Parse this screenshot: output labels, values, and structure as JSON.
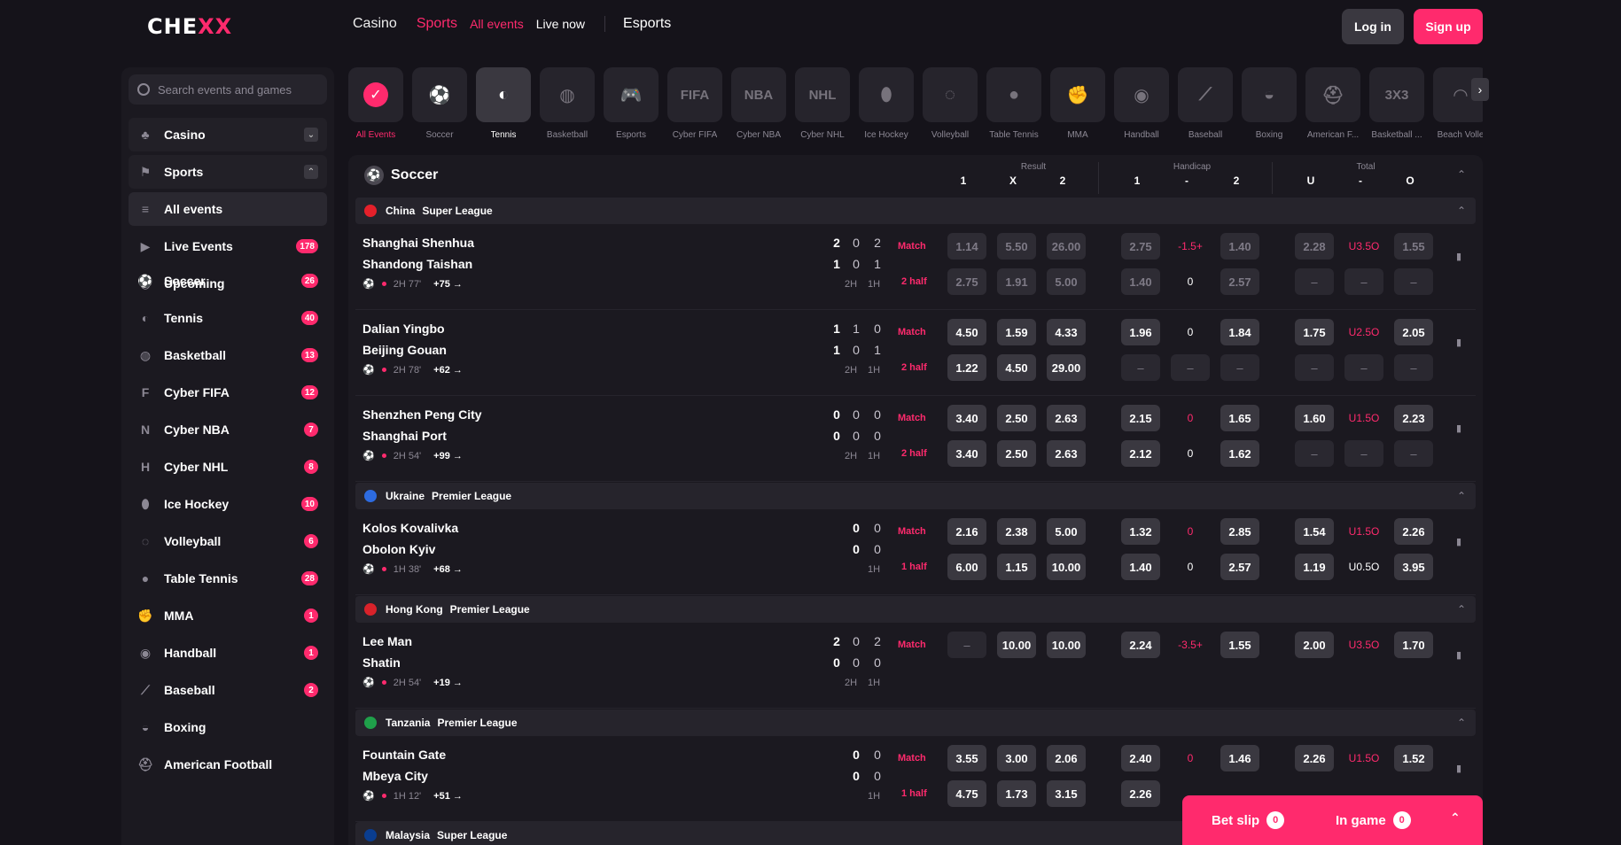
{
  "header": {
    "logo_left": "CHE",
    "logo_xx": "XX",
    "nav": {
      "casino": "Casino",
      "sports": "Sports",
      "all_events": "All events",
      "live_now": "Live now",
      "esports": "Esports"
    },
    "login": "Log in",
    "signup": "Sign up"
  },
  "sidebar": {
    "search_placeholder": "Search events and games",
    "casino": "Casino",
    "sports": "Sports",
    "items": [
      {
        "label": "All events",
        "count": "",
        "icon": "list-icon"
      },
      {
        "label": "Live Events",
        "count": "178",
        "icon": "play-icon"
      },
      {
        "label": "Upcoming",
        "count": "",
        "icon": "clock-icon"
      },
      {
        "label": "Soccer",
        "count": "26",
        "icon": "soccer-icon"
      },
      {
        "label": "Tennis",
        "count": "40",
        "icon": "tennis-icon"
      },
      {
        "label": "Basketball",
        "count": "13",
        "icon": "basketball-icon"
      },
      {
        "label": "Cyber FIFA",
        "count": "12",
        "icon": "fifa-icon"
      },
      {
        "label": "Cyber NBA",
        "count": "7",
        "icon": "nba-icon"
      },
      {
        "label": "Cyber NHL",
        "count": "8",
        "icon": "nhl-icon"
      },
      {
        "label": "Ice Hockey",
        "count": "10",
        "icon": "ice-hockey-icon"
      },
      {
        "label": "Volleyball",
        "count": "6",
        "icon": "volleyball-icon"
      },
      {
        "label": "Table Tennis",
        "count": "28",
        "icon": "table-tennis-icon"
      },
      {
        "label": "MMA",
        "count": "1",
        "icon": "mma-icon"
      },
      {
        "label": "Handball",
        "count": "1",
        "icon": "handball-icon"
      },
      {
        "label": "Baseball",
        "count": "2",
        "icon": "baseball-icon"
      },
      {
        "label": "Boxing",
        "count": "",
        "icon": "boxing-icon"
      },
      {
        "label": "American Football",
        "count": "",
        "icon": "american-football-icon"
      }
    ]
  },
  "tabs": [
    {
      "label": "All Events",
      "glyph": "✓"
    },
    {
      "label": "Soccer",
      "glyph": "⚽"
    },
    {
      "label": "Tennis",
      "glyph": "◐"
    },
    {
      "label": "Basketball",
      "glyph": "◍"
    },
    {
      "label": "Esports",
      "glyph": "🎮"
    },
    {
      "label": "Cyber FIFA",
      "glyph": "FIFA"
    },
    {
      "label": "Cyber NBA",
      "glyph": "NBA"
    },
    {
      "label": "Cyber NHL",
      "glyph": "NHL"
    },
    {
      "label": "Ice Hockey",
      "glyph": "⬮"
    },
    {
      "label": "Volleyball",
      "glyph": "◌"
    },
    {
      "label": "Table Tennis",
      "glyph": "●"
    },
    {
      "label": "MMA",
      "glyph": "✊"
    },
    {
      "label": "Handball",
      "glyph": "◉"
    },
    {
      "label": "Baseball",
      "glyph": "⟋"
    },
    {
      "label": "Boxing",
      "glyph": "◒"
    },
    {
      "label": "American F...",
      "glyph": "⛑"
    },
    {
      "label": "Basketball ...",
      "glyph": "3X3"
    },
    {
      "label": "Beach Volle",
      "glyph": "◠"
    }
  ],
  "panel": {
    "sport": "Soccer",
    "groups": {
      "result": "Result",
      "handicap": "Handicap",
      "total": "Total"
    },
    "cols": {
      "r1": "1",
      "rx": "X",
      "r2": "2",
      "h1": "1",
      "hm": "-",
      "h2": "2",
      "tu": "U",
      "tm": "-",
      "to": "O"
    }
  },
  "leagues": [
    {
      "country": "China",
      "name": "Super League"
    },
    {
      "country": "Ukraine",
      "name": "Premier League"
    },
    {
      "country": "Hong Kong",
      "name": "Premier League"
    },
    {
      "country": "Tanzania",
      "name": "Premier League"
    },
    {
      "country": "Malaysia",
      "name": "Super League"
    }
  ],
  "matches": [
    {
      "home": "Shanghai Shenhua",
      "away": "Shandong Taishan",
      "s1": [
        "2",
        "0",
        "2"
      ],
      "s2": [
        "1",
        "0",
        "1"
      ],
      "periods": [
        "2H",
        "1H"
      ],
      "time": "2H 77'",
      "more": "+75 →",
      "row1": {
        "market": "Match",
        "r": [
          "1.14",
          "5.50",
          "26.00"
        ],
        "h1": "2.75",
        "hc": "-1.5+",
        "h2": "1.40",
        "u": "2.28",
        "tot": "U3.5O",
        "o": "1.55"
      },
      "row2": {
        "market": "2 half",
        "r": [
          "2.75",
          "1.91",
          "5.00"
        ],
        "h1": "1.40",
        "hc": "0",
        "h2": "2.57",
        "u": "–",
        "tot": "–",
        "o": "–"
      }
    },
    {
      "home": "Dalian Yingbo",
      "away": "Beijing Gouan",
      "s1": [
        "1",
        "1",
        "0"
      ],
      "s2": [
        "1",
        "0",
        "1"
      ],
      "periods": [
        "2H",
        "1H"
      ],
      "time": "2H 78'",
      "more": "+62 →",
      "row1": {
        "market": "Match",
        "r": [
          "4.50",
          "1.59",
          "4.33"
        ],
        "h1": "1.96",
        "hc": "0",
        "h2": "1.84",
        "u": "1.75",
        "tot": "U2.5O",
        "o": "2.05"
      },
      "row2": {
        "market": "2 half",
        "r": [
          "1.22",
          "4.50",
          "29.00"
        ],
        "h1": "–",
        "hc": "–",
        "h2": "–",
        "u": "–",
        "tot": "–",
        "o": "–"
      }
    },
    {
      "home": "Shenzhen Peng City",
      "away": "Shanghai Port",
      "s1": [
        "0",
        "0",
        "0"
      ],
      "s2": [
        "0",
        "0",
        "0"
      ],
      "periods": [
        "2H",
        "1H"
      ],
      "time": "2H 54'",
      "more": "+99 →",
      "row1": {
        "market": "Match",
        "r": [
          "3.40",
          "2.50",
          "2.63"
        ],
        "h1": "2.15",
        "hc": "0",
        "h2": "1.65",
        "u": "1.60",
        "tot": "U1.5O",
        "o": "2.23"
      },
      "row2": {
        "market": "2 half",
        "r": [
          "3.40",
          "2.50",
          "2.63"
        ],
        "h1": "2.12",
        "hc": "0",
        "h2": "1.62",
        "u": "–",
        "tot": "–",
        "o": "–"
      }
    },
    {
      "home": "Kolos Kovalivka",
      "away": "Obolon Kyiv",
      "s1": [
        "0",
        "0"
      ],
      "s2": [
        "0",
        "0"
      ],
      "periods": [
        "1H"
      ],
      "time": "1H 38'",
      "more": "+68 →",
      "row1": {
        "market": "Match",
        "r": [
          "2.16",
          "2.38",
          "5.00"
        ],
        "h1": "1.32",
        "hc": "0",
        "h2": "2.85",
        "u": "1.54",
        "tot": "U1.5O",
        "o": "2.26"
      },
      "row2": {
        "market": "1 half",
        "r": [
          "6.00",
          "1.15",
          "10.00"
        ],
        "h1": "1.40",
        "hc": "0",
        "h2": "2.57",
        "u": "1.19",
        "tot": "U0.5O",
        "o": "3.95"
      }
    },
    {
      "home": "Lee Man",
      "away": "Shatin",
      "s1": [
        "2",
        "0",
        "2"
      ],
      "s2": [
        "0",
        "0",
        "0"
      ],
      "periods": [
        "2H",
        "1H"
      ],
      "time": "2H 54'",
      "more": "+19 →",
      "row1": {
        "market": "Match",
        "r": [
          "–",
          "10.00",
          "10.00"
        ],
        "h1": "2.24",
        "hc": "-3.5+",
        "h2": "1.55",
        "u": "2.00",
        "tot": "U3.5O",
        "o": "1.70"
      }
    },
    {
      "home": "Fountain Gate",
      "away": "Mbeya City",
      "s1": [
        "0",
        "0"
      ],
      "s2": [
        "0",
        "0"
      ],
      "periods": [
        "1H"
      ],
      "time": "1H 12'",
      "more": "+51 →",
      "row1": {
        "market": "Match",
        "r": [
          "3.55",
          "3.00",
          "2.06"
        ],
        "h1": "2.40",
        "hc": "0",
        "h2": "1.46",
        "u": "2.26",
        "tot": "U1.5O",
        "o": "1.52"
      },
      "row2": {
        "market": "1 half",
        "r": [
          "4.75",
          "1.73",
          "3.15"
        ],
        "h1": "2.26",
        "hc": "",
        "h2": "",
        "u": "",
        "tot": "",
        "o": ""
      }
    }
  ],
  "betslip": {
    "bet_slip": "Bet slip",
    "bet_count": "0",
    "in_game": "In game",
    "in_game_count": "0"
  },
  "colors": {
    "accent": "#ff2a6d",
    "bg": "#15131a",
    "panel": "#1b1920",
    "odd_bg": "#3a3840"
  }
}
